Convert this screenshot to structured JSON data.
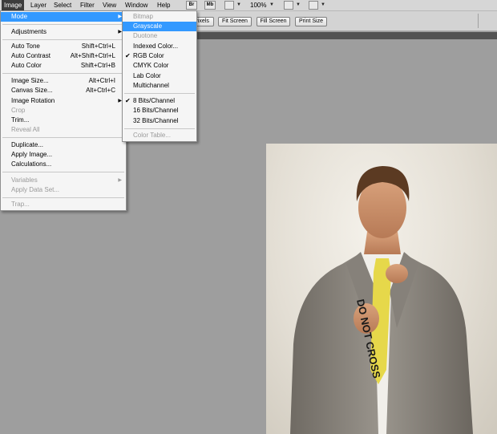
{
  "menubar": {
    "items": [
      "Image",
      "Layer",
      "Select",
      "Filter",
      "View",
      "Window",
      "Help"
    ],
    "icons": [
      "Br",
      "Mb"
    ],
    "zoom": "100%"
  },
  "options": {
    "buttons": [
      "Pixels",
      "Fit Screen",
      "Fill Screen",
      "Print Size"
    ]
  },
  "image_menu": {
    "items": [
      {
        "label": "Mode",
        "submenu": true,
        "highlighted": true
      },
      {
        "label": "Adjustments",
        "submenu": true
      },
      {
        "label": "Auto Tone",
        "shortcut": "Shift+Ctrl+L"
      },
      {
        "label": "Auto Contrast",
        "shortcut": "Alt+Shift+Ctrl+L"
      },
      {
        "label": "Auto Color",
        "shortcut": "Shift+Ctrl+B"
      },
      {
        "label": "Image Size...",
        "shortcut": "Alt+Ctrl+I"
      },
      {
        "label": "Canvas Size...",
        "shortcut": "Alt+Ctrl+C"
      },
      {
        "label": "Image Rotation",
        "submenu": true
      },
      {
        "label": "Crop",
        "disabled": true
      },
      {
        "label": "Trim..."
      },
      {
        "label": "Reveal All",
        "disabled": true
      },
      {
        "label": "Duplicate..."
      },
      {
        "label": "Apply Image..."
      },
      {
        "label": "Calculations..."
      },
      {
        "label": "Variables",
        "submenu": true,
        "disabled": true
      },
      {
        "label": "Apply Data Set...",
        "disabled": true
      },
      {
        "label": "Trap...",
        "disabled": true
      }
    ]
  },
  "mode_menu": {
    "items": [
      {
        "label": "Bitmap",
        "disabled": true
      },
      {
        "label": "Grayscale",
        "highlighted": true
      },
      {
        "label": "Duotone",
        "disabled": true
      },
      {
        "label": "Indexed Color..."
      },
      {
        "label": "RGB Color",
        "checked": true
      },
      {
        "label": "CMYK Color"
      },
      {
        "label": "Lab Color"
      },
      {
        "label": "Multichannel"
      },
      {
        "label": "8 Bits/Channel",
        "checked": true
      },
      {
        "label": "16 Bits/Channel"
      },
      {
        "label": "32 Bits/Channel"
      },
      {
        "label": "Color Table...",
        "disabled": true
      }
    ]
  },
  "photo": {
    "tie_text": "DO NOT CROSS"
  }
}
